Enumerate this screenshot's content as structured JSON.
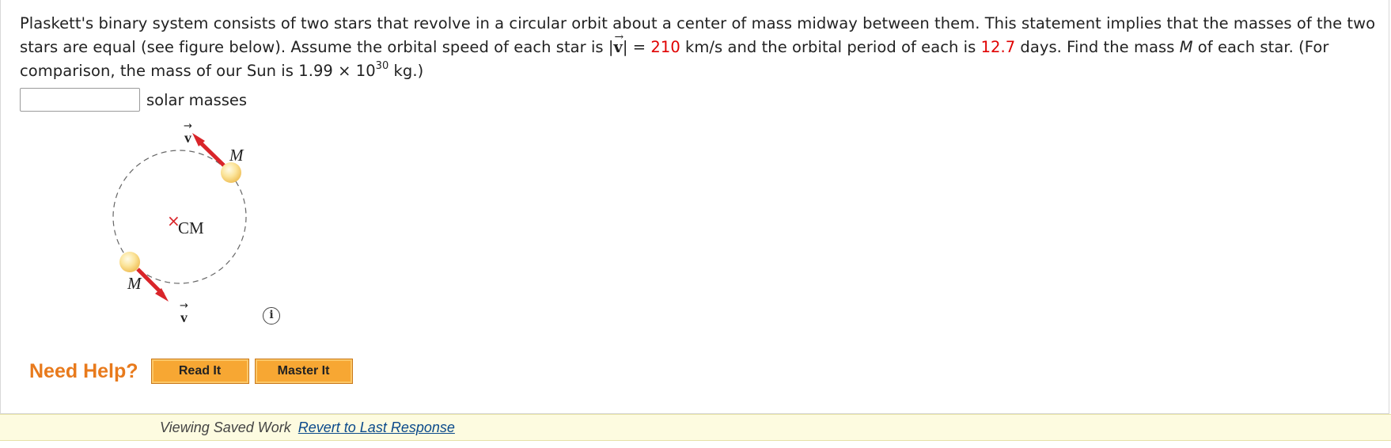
{
  "problem": {
    "part1": "Plaskett's binary system consists of two stars that revolve in a circular orbit about a center of mass midway between them. This statement implies that the masses of the two stars are equal (see figure below). Assume the orbital speed of each star is |",
    "vec_symbol": "v",
    "vec_arrow": "→",
    "part2": "| = ",
    "speed_value": "210",
    "part3": " km/s and the orbital period of each is ",
    "period_value": "12.7",
    "part4": " days. Find the mass ",
    "mass_symbol": "M",
    "part5": " of each star. (For comparison, the mass of our Sun is 1.99 × 10",
    "exponent": "30",
    "part6": " kg.)"
  },
  "answer": {
    "value": "",
    "placeholder": "",
    "units": "solar masses"
  },
  "figure": {
    "top_mass_label": "M",
    "bottom_mass_label": "M",
    "cm_label": "CM",
    "cm_marker": "×",
    "top_vector_label": "v",
    "bottom_vector_label": "v",
    "vector_arrow": "→",
    "info_icon": "info-icon",
    "info_glyph": "i"
  },
  "help": {
    "label": "Need Help?",
    "read_it": "Read It",
    "master_it": "Master It"
  },
  "status": {
    "text": "Viewing Saved Work",
    "link": "Revert to Last Response"
  },
  "colors": {
    "highlight_red": "#e00000",
    "help_orange": "#e87a1c",
    "button_orange": "#f7a733",
    "arrow_red": "#d9252a",
    "star_yellow": "#f9d77e",
    "status_bg": "#fdfbe0",
    "link_blue": "#0b4a8b"
  }
}
